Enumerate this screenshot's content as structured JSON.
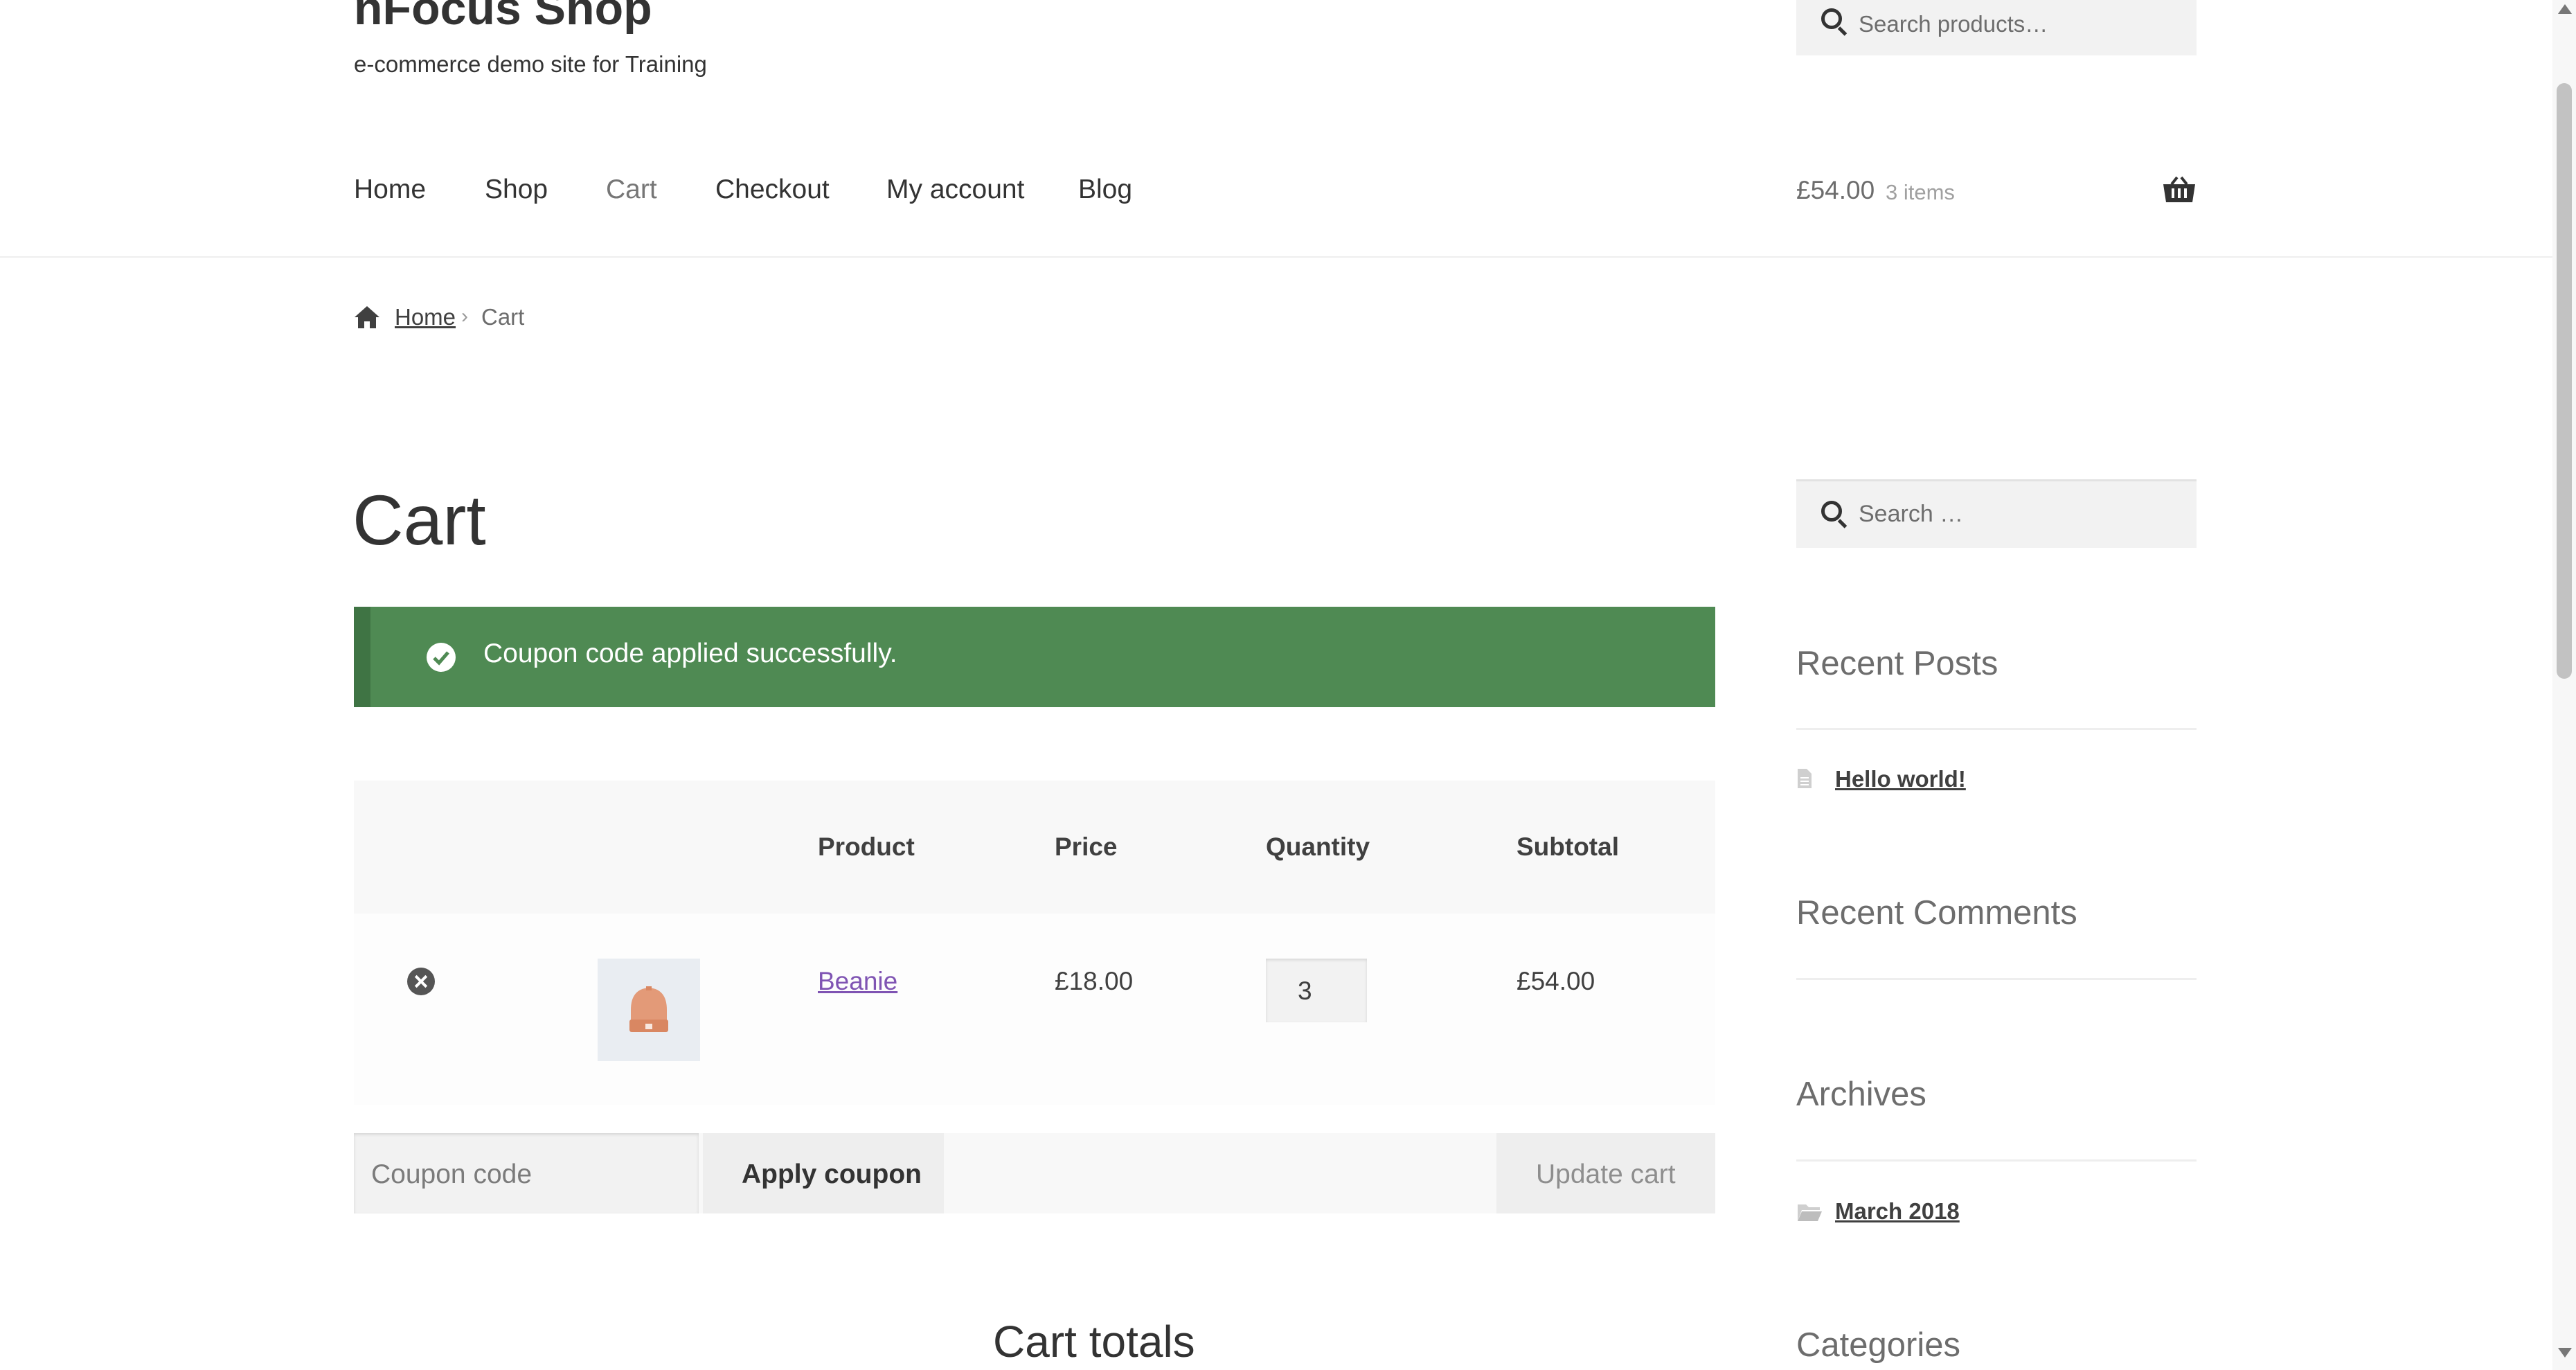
{
  "header": {
    "site_title": "nFocus Shop",
    "site_description": "e-commerce demo site for Training",
    "search_placeholder": "Search products…",
    "cart_total": "£54.00",
    "cart_count": "3 items"
  },
  "nav": {
    "items": [
      {
        "label": "Home"
      },
      {
        "label": "Shop"
      },
      {
        "label": "Cart"
      },
      {
        "label": "Checkout"
      },
      {
        "label": "My account"
      },
      {
        "label": "Blog"
      }
    ],
    "current": "Cart"
  },
  "breadcrumb": {
    "home": "Home",
    "separator": "›",
    "current": "Cart"
  },
  "main": {
    "title": "Cart",
    "notice": "Coupon code applied successfully.",
    "table": {
      "headers": [
        "Product",
        "Price",
        "Quantity",
        "Subtotal"
      ],
      "rows": [
        {
          "product": "Beanie",
          "price": "£18.00",
          "quantity": "3",
          "subtotal": "£54.00"
        }
      ]
    },
    "coupon_placeholder": "Coupon code",
    "apply_coupon": "Apply coupon",
    "update_cart": "Update cart",
    "cart_totals_title": "Cart totals"
  },
  "sidebar": {
    "search_placeholder": "Search …",
    "recent_posts_title": "Recent Posts",
    "recent_posts": [
      "Hello world!"
    ],
    "recent_comments_title": "Recent Comments",
    "archives_title": "Archives",
    "archives": [
      "March 2018"
    ],
    "categories_title": "Categories"
  },
  "colors": {
    "notice_bg": "#4f8a53",
    "link": "#7f54b3",
    "text": "#404040"
  },
  "icons": [
    "search-icon",
    "basket-icon",
    "home-icon",
    "check-circle-icon",
    "remove-item-icon",
    "beanie-thumbnail",
    "document-icon",
    "folder-icon"
  ]
}
